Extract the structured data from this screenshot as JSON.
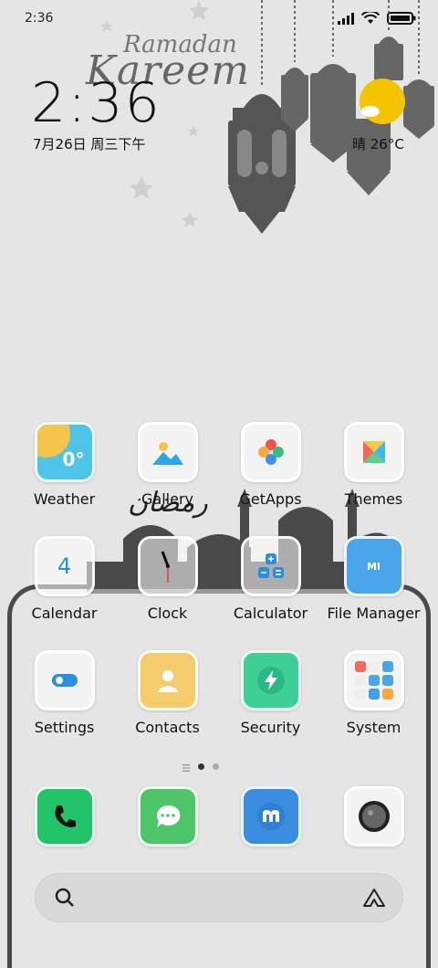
{
  "status_bar": {
    "time": "2:36"
  },
  "header": {
    "greeting_line1": "Ramadan",
    "greeting_line2": "Kareem",
    "clock": "2:36",
    "date": "7月26日 周三下午",
    "weather": "晴 26°C"
  },
  "apps": [
    {
      "label": "Weather",
      "icon": "weather-icon",
      "badge": "0°"
    },
    {
      "label": "Gallery",
      "icon": "gallery-icon"
    },
    {
      "label": "GetApps",
      "icon": "getapps-icon"
    },
    {
      "label": "Themes",
      "icon": "themes-icon"
    },
    {
      "label": "Calendar",
      "icon": "calendar-icon",
      "badge": "4"
    },
    {
      "label": "Clock",
      "icon": "clock-icon"
    },
    {
      "label": "Calculator",
      "icon": "calculator-icon"
    },
    {
      "label": "File Manager",
      "icon": "file-manager-icon",
      "badge": "MI"
    },
    {
      "label": "Settings",
      "icon": "settings-icon"
    },
    {
      "label": "Contacts",
      "icon": "contacts-icon"
    },
    {
      "label": "Security",
      "icon": "security-icon"
    },
    {
      "label": "System",
      "icon": "system-folder-icon"
    }
  ],
  "dock": [
    {
      "icon": "phone-icon"
    },
    {
      "icon": "messages-icon"
    },
    {
      "icon": "browser-icon"
    },
    {
      "icon": "camera-icon"
    }
  ],
  "page_indicator": {
    "pages": 2,
    "current": 1
  },
  "colors": {
    "background": "#e5e5e5",
    "weather_sun": "#f5c400",
    "phone_green": "#22c46a",
    "messages_green": "#4fc56a",
    "browser_blue": "#3a8de0",
    "panel_border": "#4a4a4a"
  }
}
